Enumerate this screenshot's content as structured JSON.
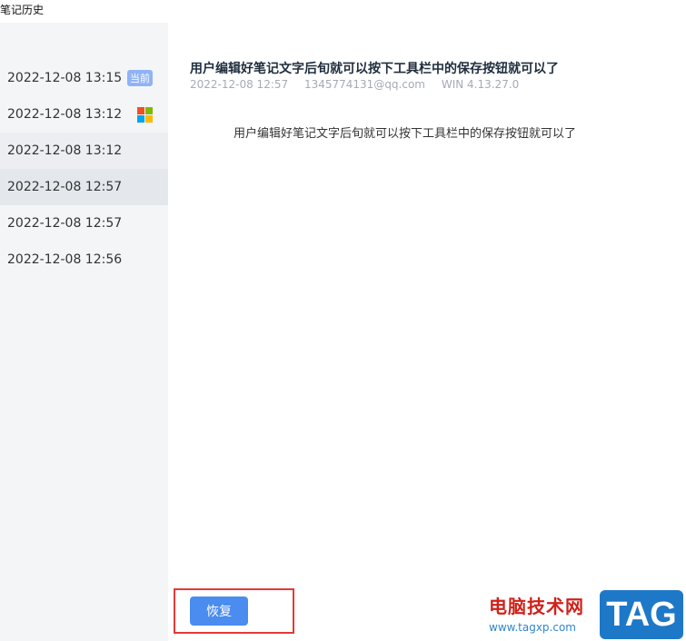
{
  "window": {
    "title": "笔记历史"
  },
  "sidebar": {
    "items": [
      {
        "time": "2022-12-08 13:15",
        "badge": "当前"
      },
      {
        "time": "2022-12-08 13:12",
        "icon": "windows-logo-icon"
      },
      {
        "time": "2022-12-08 13:12"
      },
      {
        "time": "2022-12-08 12:57"
      },
      {
        "time": "2022-12-08 12:57"
      },
      {
        "time": "2022-12-08 12:56"
      }
    ]
  },
  "detail": {
    "title": "用户编辑好笔记文字后旬就可以按下工具栏中的保存按钮就可以了",
    "meta": {
      "time": "2022-12-08 12:57",
      "account": "1345774131@qq.com",
      "client": "WIN 4.13.27.0"
    },
    "body": "用户编辑好笔记文字后旬就可以按下工具栏中的保存按钮就可以了"
  },
  "actions": {
    "restore_label": "恢复"
  },
  "watermark": {
    "site_name": "电脑技术网",
    "url": "www.tagxp.com",
    "logo_text": "TAG"
  },
  "colors": {
    "sidebar_bg": "#f4f5f7",
    "selected_bg": "#e4e7ec",
    "badge": "#8fb3f5",
    "primary_button": "#4a8cf0",
    "highlight_border": "#e53935"
  }
}
